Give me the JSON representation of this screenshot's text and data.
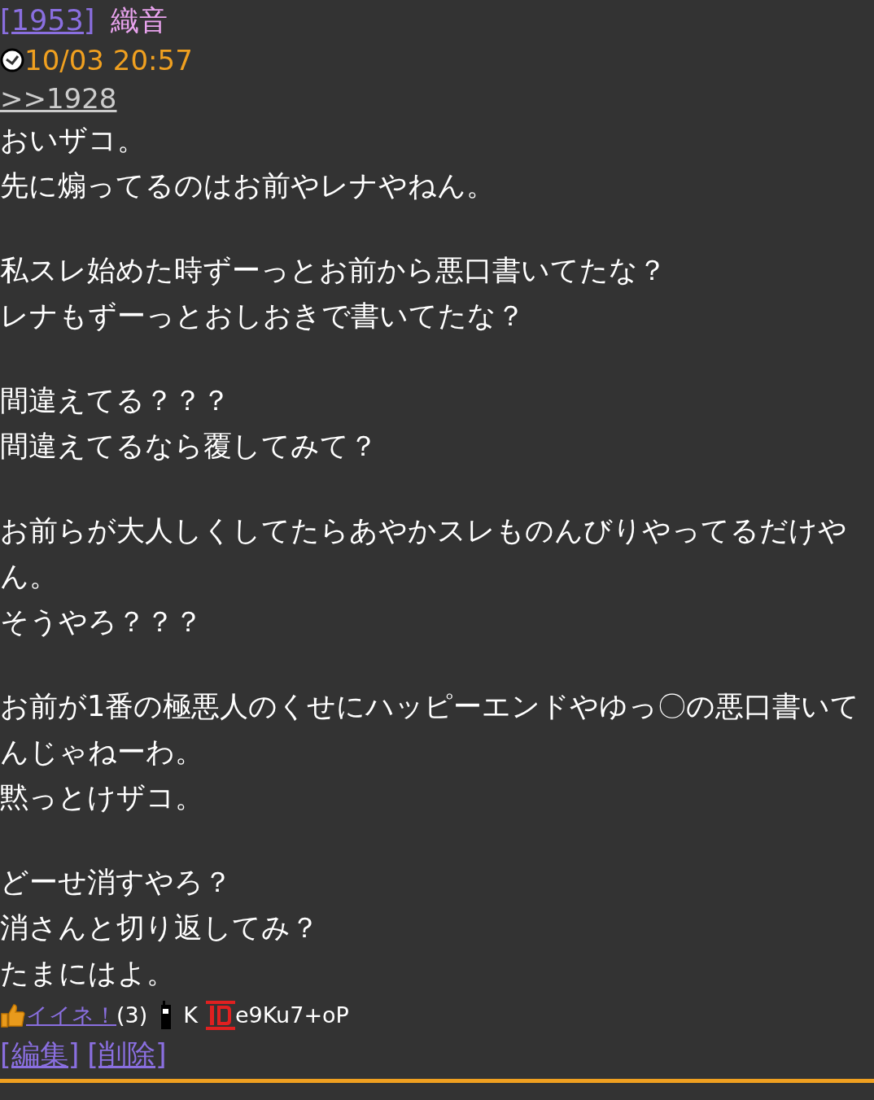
{
  "post": {
    "number": "[1953]",
    "author": "織音",
    "timestamp": "10/03 20:57",
    "reply_link": ">>1928",
    "paragraphs": [
      [
        "おいザコ。",
        "先に煽ってるのはお前やレナやねん。"
      ],
      [
        "私スレ始めた時ずーっとお前から悪口書いてたな？",
        "レナもずーっとおしおきで書いてたな？"
      ],
      [
        "間違えてる？？？",
        "間違えてるなら覆してみて？"
      ],
      [
        "お前らが大人しくしてたらあやかスレものんびりやってるだけやん。",
        "そうやろ？？？"
      ],
      [
        "お前が1番の極悪人のくせにハッピーエンドやゆっ〇の悪口書いてんじゃねーわ。",
        "黙っとけザコ。"
      ],
      [
        "どーせ消すやろ？",
        "消さんと切り返してみ？",
        "たまにはよ。"
      ]
    ],
    "like_label": "イイネ！",
    "like_count": "(3)",
    "device": "K",
    "id": "e9Ku7+oP",
    "actions": [
      "[編集]",
      "[削除]"
    ]
  }
}
